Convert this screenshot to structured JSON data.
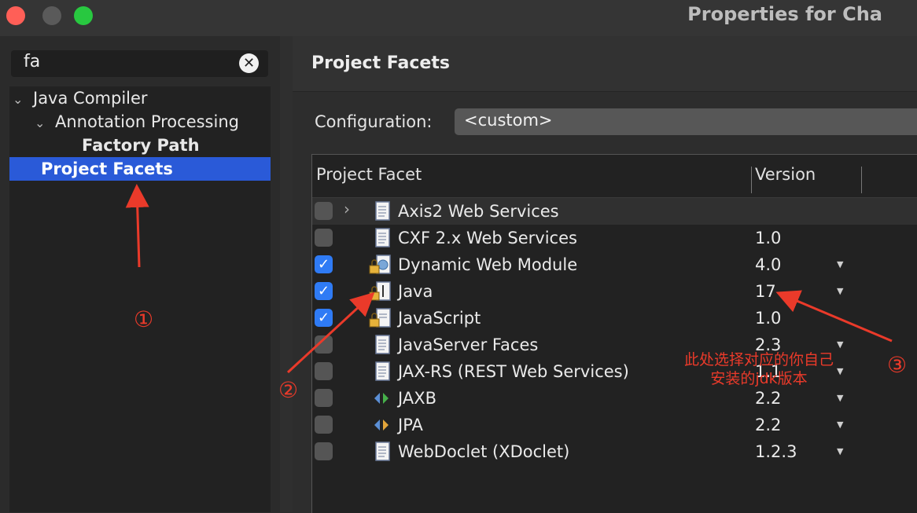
{
  "window": {
    "title": "Properties for Cha"
  },
  "sidebar": {
    "filter_value": "fa",
    "clear_symbol": "✕",
    "tree": [
      {
        "label": "Java Compiler",
        "level": 0,
        "expanded": true
      },
      {
        "label": "Annotation Processing",
        "level": 1,
        "expanded": true
      },
      {
        "label": "Factory Path",
        "level": 2,
        "bold": true
      },
      {
        "label": "Project Facets",
        "level": 0,
        "bold": true,
        "selected": true
      }
    ]
  },
  "main": {
    "title": "Project Facets",
    "configuration_label": "Configuration:",
    "configuration_value": "<custom>",
    "columns": {
      "facet": "Project Facet",
      "version": "Version"
    },
    "facets": [
      {
        "name": "Axis2 Web Services",
        "version": "",
        "checked": false,
        "expandable": true,
        "icon": "document-icon",
        "dropdown": false
      },
      {
        "name": "CXF 2.x Web Services",
        "version": "1.0",
        "checked": false,
        "icon": "document-icon",
        "dropdown": false
      },
      {
        "name": "Dynamic Web Module",
        "version": "4.0",
        "checked": true,
        "icon": "locked-web-module-icon",
        "dropdown": true
      },
      {
        "name": "Java",
        "version": "17",
        "checked": true,
        "icon": "locked-java-icon",
        "dropdown": true
      },
      {
        "name": "JavaScript",
        "version": "1.0",
        "checked": true,
        "icon": "locked-document-icon",
        "dropdown": false
      },
      {
        "name": "JavaServer Faces",
        "version": "2.3",
        "checked": false,
        "icon": "document-icon",
        "dropdown": true
      },
      {
        "name": "JAX-RS (REST Web Services)",
        "version": "1.1",
        "checked": false,
        "icon": "document-icon",
        "dropdown": true
      },
      {
        "name": "JAXB",
        "version": "2.2",
        "checked": false,
        "icon": "jaxb-icon",
        "dropdown": true
      },
      {
        "name": "JPA",
        "version": "2.2",
        "checked": false,
        "icon": "jpa-icon",
        "dropdown": true
      },
      {
        "name": "WebDoclet (XDoclet)",
        "version": "1.2.3",
        "checked": false,
        "icon": "document-icon",
        "dropdown": true
      }
    ]
  },
  "annotations": {
    "marker_1": "①",
    "marker_2": "②",
    "marker_3": "③",
    "note": "此处选择对应的你自己安装的jdk版本",
    "color": "#ea3a2a"
  },
  "colors": {
    "selection": "#2a5ad8",
    "checkbox_checked": "#2f7bf5"
  }
}
